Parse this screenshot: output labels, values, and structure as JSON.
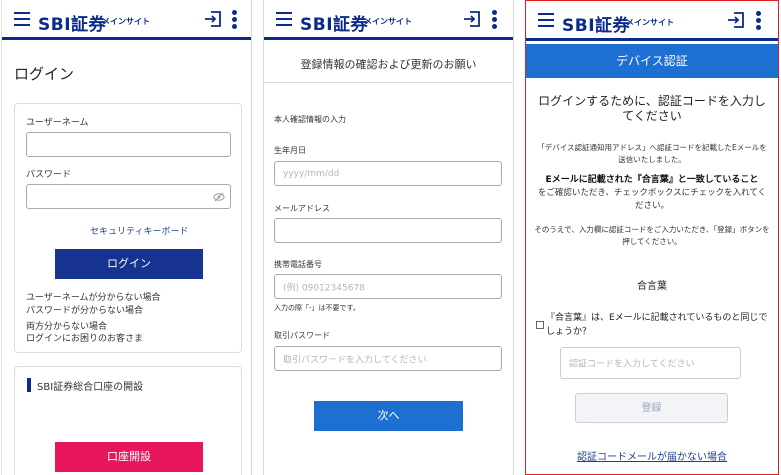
{
  "brand": {
    "logo": "SBI証券",
    "subtitle": "メインサイト"
  },
  "colors": {
    "navy": "#0a2a8c",
    "button_navy": "#16338f",
    "button_blue": "#1d6fd1",
    "pink": "#e8175d"
  },
  "panel1": {
    "title": "ログイン",
    "username_label": "ユーザーネーム",
    "password_label": "パスワード",
    "security_keyboard": "セキュリティキーボード",
    "login_button": "ログイン",
    "links": [
      "ユーザーネームが分からない場合",
      "パスワードが分からない場合",
      "両方分からない場合",
      "ログインにお困りのお客さま"
    ],
    "open_account_title": "SBI証券総合口座の開設",
    "open_account_button": "口座開設"
  },
  "panel2": {
    "title": "登録情報の確認および更新のお願い",
    "section": "本人確認情報の入力",
    "birth_label": "生年月日",
    "birth_placeholder": "yyyy/mm/dd",
    "email_label": "メールアドレス",
    "phone_label": "携帯電話番号",
    "phone_placeholder": "(例) 09012345678",
    "phone_note": "入力の際「-」は不要です。",
    "trade_pw_label": "取引パスワード",
    "trade_pw_placeholder": "取引パスワードを入力してください",
    "next_button": "次へ"
  },
  "panel3": {
    "banner": "デバイス認証",
    "heading": "ログインするために、認証コードを入力してください",
    "desc1": "「デバイス認証通知用アドレス」へ認証コードを記載したEメールを送信いたしました。",
    "emphasis": "Eメールに記載された『合言葉』と一致していること",
    "desc2": "をご確認いただき、チェックボックスにチェックを入れてください。",
    "desc3": "そのうえで、入力欄に認証コードをご入力いただき、「登録」ボタンを押してください。",
    "passphrase_label": "合言葉",
    "checkbox_text": "『合言葉』は、Eメールに記載されているものと同じでしょうか？",
    "code_placeholder": "認証コードを入力してください",
    "register_button": "登録",
    "no_email_link": "認証コードメールが届かない場合"
  }
}
